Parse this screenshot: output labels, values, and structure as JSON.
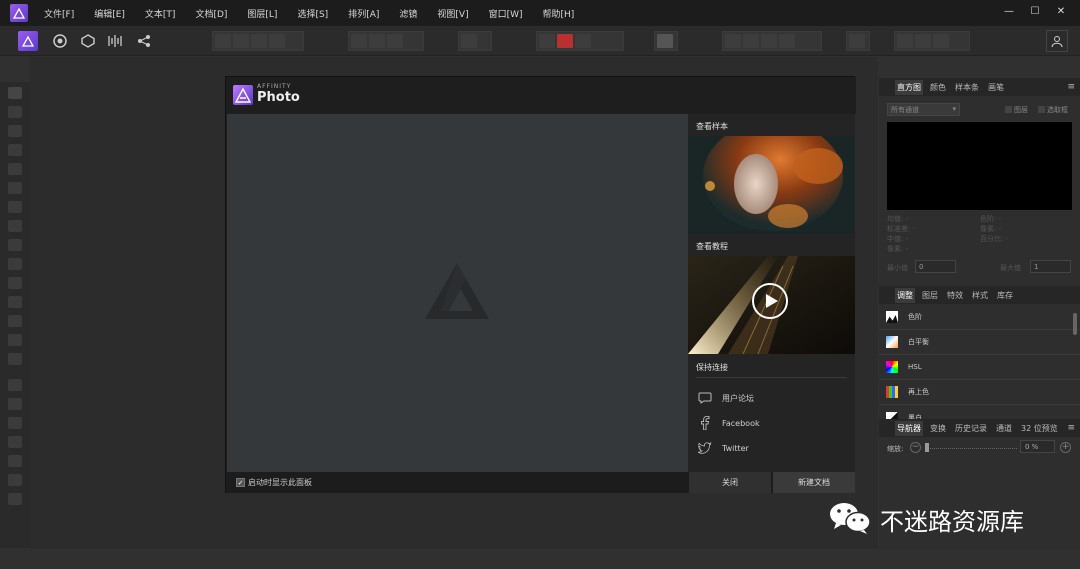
{
  "menu": {
    "items": [
      "文件[F]",
      "编辑[E]",
      "文本[T]",
      "文档[D]",
      "图层[L]",
      "选择[S]",
      "排列[A]",
      "滤镜",
      "视图[V]",
      "窗口[W]",
      "帮助[H]"
    ]
  },
  "window_controls": {
    "minimize": "—",
    "maximize": "☐",
    "close": "✕"
  },
  "histogram_panel": {
    "tabs": [
      "直方图",
      "颜色",
      "样本条",
      "画笔"
    ],
    "channel": "所有通道",
    "layer_check": "图层",
    "selection_check": "选取框",
    "stats_left": [
      "均值: -",
      "标准差: -",
      "中值: -",
      "像素: -"
    ],
    "stats_right": [
      "色阶: -",
      "像素: -",
      "百分比: -"
    ],
    "min_label": "最小值",
    "min_value": "0",
    "max_label": "最大值",
    "max_value": "1"
  },
  "adjust_panel": {
    "tabs": [
      "调整",
      "图层",
      "特效",
      "样式",
      "库存"
    ],
    "items": [
      "色阶",
      "白平衡",
      "HSL",
      "再上色",
      "黑白"
    ]
  },
  "navigator_panel": {
    "tabs": [
      "导航器",
      "变换",
      "历史记录",
      "通道",
      "32 位预览"
    ],
    "zoom_label": "缩放:",
    "zoom_value": "0 %"
  },
  "dialog": {
    "brand_small": "AFFINITY",
    "brand": "Photo",
    "samples_heading": "查看样本",
    "tutorials_heading": "查看教程",
    "connect_heading": "保持连接",
    "social": [
      "用户论坛",
      "Facebook",
      "Twitter"
    ],
    "startup_checkbox": "启动时显示此面板",
    "close_button": "关闭",
    "new_doc_button": "新建文档"
  },
  "watermark": {
    "text": "不迷路资源库"
  },
  "colors": {
    "accent": "#8a4fe8",
    "dialog_bg": "#1f1f1f",
    "canvas": "#35383b"
  }
}
